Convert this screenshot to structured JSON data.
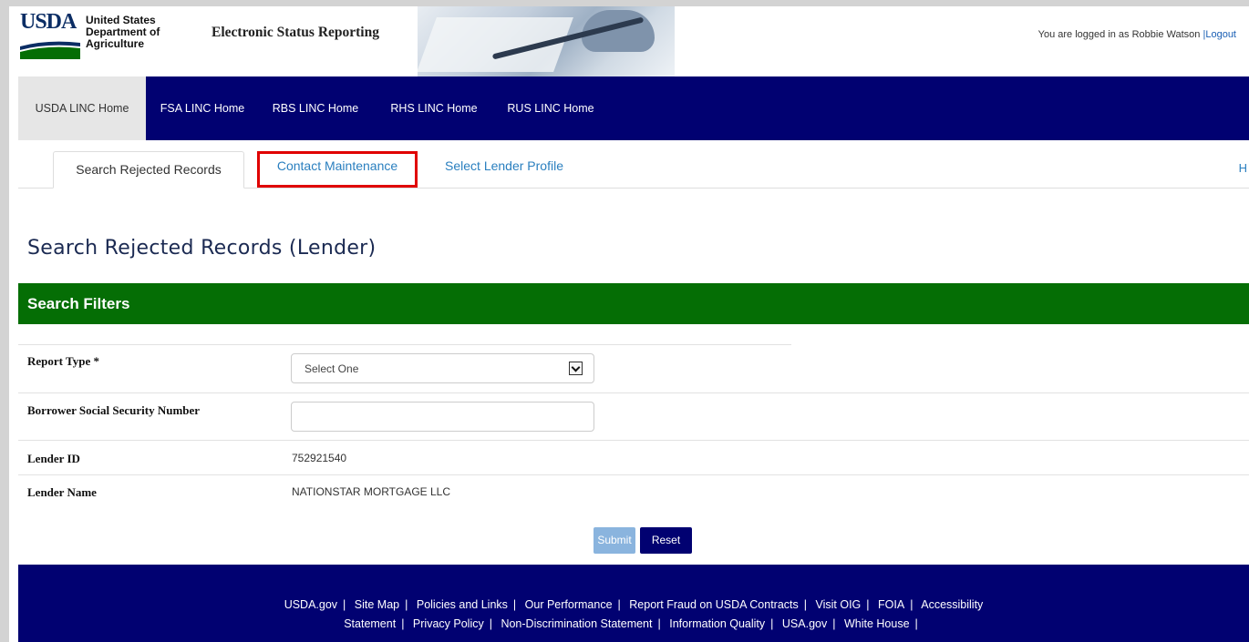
{
  "header": {
    "logo_text": "USDA",
    "agency_lines": [
      "United States",
      "Department of",
      "Agriculture"
    ],
    "app_title": "Electronic Status Reporting",
    "login_text": "You are logged in as Robbie Watson",
    "logout_label": "|Logout"
  },
  "nav": {
    "items": [
      {
        "label": "USDA LINC Home",
        "active": true
      },
      {
        "label": "FSA LINC Home"
      },
      {
        "label": "RBS LINC Home"
      },
      {
        "label": "RHS LINC Home"
      },
      {
        "label": "RUS LINC Home"
      }
    ]
  },
  "tabs": {
    "items": [
      {
        "label": "Search Rejected Records",
        "active": true
      },
      {
        "label": "Contact Maintenance",
        "highlighted": true
      },
      {
        "label": "Select Lender Profile"
      }
    ],
    "help_partial": "H"
  },
  "main": {
    "page_title": "Search Rejected Records (Lender)",
    "panel_title": "Search Filters",
    "fields": {
      "report_type": {
        "label": "Report Type *",
        "selected": "Select One"
      },
      "ssn": {
        "label": "Borrower Social Security Number",
        "value": ""
      },
      "lender_id": {
        "label": "Lender ID",
        "value": "752921540"
      },
      "lender_name": {
        "label": "Lender Name",
        "value": "NATIONSTAR MORTGAGE LLC"
      }
    },
    "submit_label": "Submit",
    "reset_label": "Reset"
  },
  "footer": {
    "line1": [
      "USDA.gov",
      "Site Map",
      "Policies and Links",
      "Our Performance",
      "Report Fraud on USDA Contracts",
      "Visit OIG",
      "FOIA",
      "Accessibility"
    ],
    "line2": [
      "Statement",
      "Privacy Policy",
      "Non-Discrimination Statement",
      "Information Quality",
      "USA.gov",
      "White House"
    ]
  },
  "colors": {
    "nav_bg": "#010171",
    "panel_green": "#056e05",
    "link_blue": "#2a7fbf",
    "highlight_red": "#e00000",
    "submit_disabled": "#8ab4de"
  }
}
